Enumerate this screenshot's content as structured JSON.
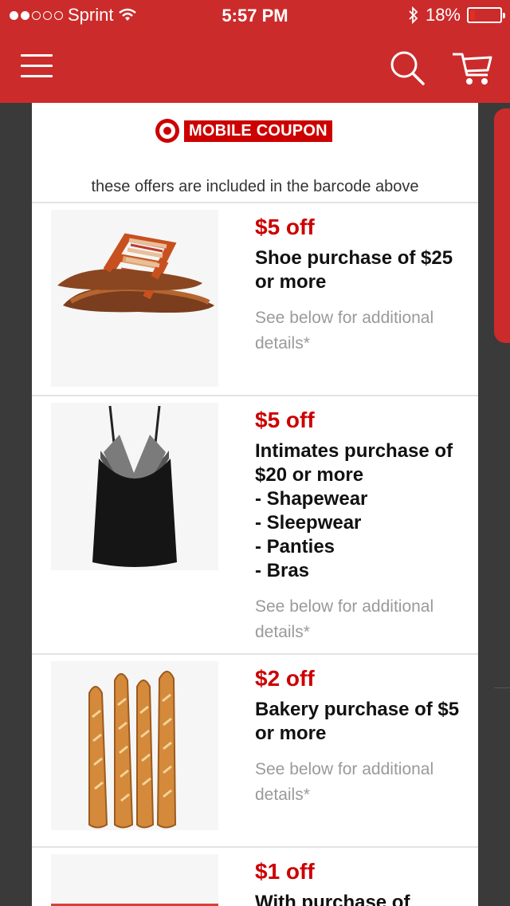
{
  "status_bar": {
    "carrier": "Sprint",
    "time": "5:57 PM",
    "battery": "18%",
    "battery_level": 0.18
  },
  "nav": {
    "menu_icon": "hamburger-icon",
    "search_icon": "search-icon",
    "cart_icon": "cart-icon",
    "brand_color": "#cc2b2b"
  },
  "coupon": {
    "badge_label": "MOBILE COUPON",
    "note": "these offers are included in the barcode above",
    "offers": [
      {
        "amount": "$5 off",
        "description": "Shoe purchase of $25 or more",
        "details": "See below for additional details*",
        "image": "sandals"
      },
      {
        "amount": "$5 off",
        "description": "Intimates purchase of $20 or more",
        "items": [
          "- Shapewear",
          "- Sleepwear",
          "- Panties",
          "- Bras"
        ],
        "details": "See below for additional details*",
        "image": "black-slip"
      },
      {
        "amount": "$2 off",
        "description": "Bakery purchase of $5 or more",
        "details": "See below for additional details*",
        "image": "baguettes"
      },
      {
        "amount": "$1 off",
        "description": "With purchase of",
        "image": "product"
      }
    ]
  }
}
